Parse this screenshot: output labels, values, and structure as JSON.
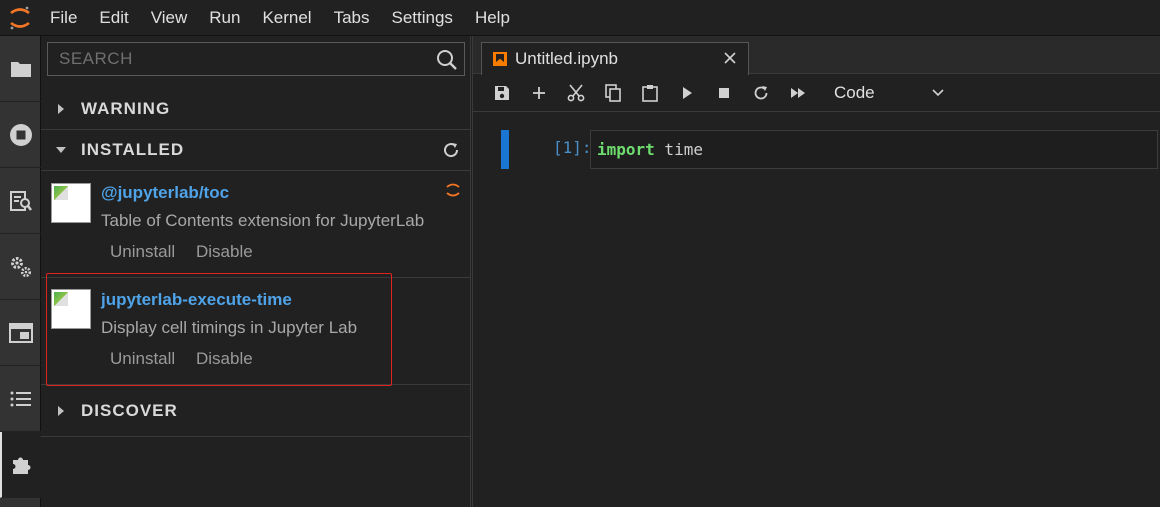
{
  "menubar": {
    "items": [
      "File",
      "Edit",
      "View",
      "Run",
      "Kernel",
      "Tabs",
      "Settings",
      "Help"
    ]
  },
  "activity_bar": {
    "icons": [
      "folder-icon",
      "stop-circle-icon",
      "property-inspector-icon",
      "gears-icon",
      "window-icon",
      "toc-list-icon",
      "puzzle-icon"
    ],
    "active": "puzzle-icon"
  },
  "extensions": {
    "search": {
      "placeholder": "SEARCH",
      "value": ""
    },
    "sections": {
      "warning": "WARNING",
      "installed": "INSTALLED",
      "discover": "DISCOVER"
    },
    "installed": [
      {
        "name": "@jupyterlab/toc",
        "description": "Table of Contents extension for JupyterLab",
        "uninstall": "Uninstall",
        "disable": "Disable",
        "status_icon": "jupyter-busy-icon"
      },
      {
        "name": "jupyterlab-execute-time",
        "description": "Display cell timings in Jupyter Lab",
        "uninstall": "Uninstall",
        "disable": "Disable"
      }
    ],
    "highlight_color": "#e0231f"
  },
  "notebook": {
    "tab": {
      "title": "Untitled.ipynb"
    },
    "toolbar": {
      "icons": [
        "save-icon",
        "add-cell-icon",
        "cut-icon",
        "copy-icon",
        "paste-icon",
        "run-icon",
        "stop-icon",
        "restart-icon",
        "fast-forward-icon"
      ],
      "cell_type": "Code"
    },
    "cells": [
      {
        "prompt": "[1]:",
        "keyword": "import",
        "rest": " time"
      }
    ]
  },
  "colors": {
    "accent": "#1976d2",
    "link": "#4fa3e8",
    "keyword": "#6edc6e",
    "notebook_icon": "#f57c00"
  }
}
